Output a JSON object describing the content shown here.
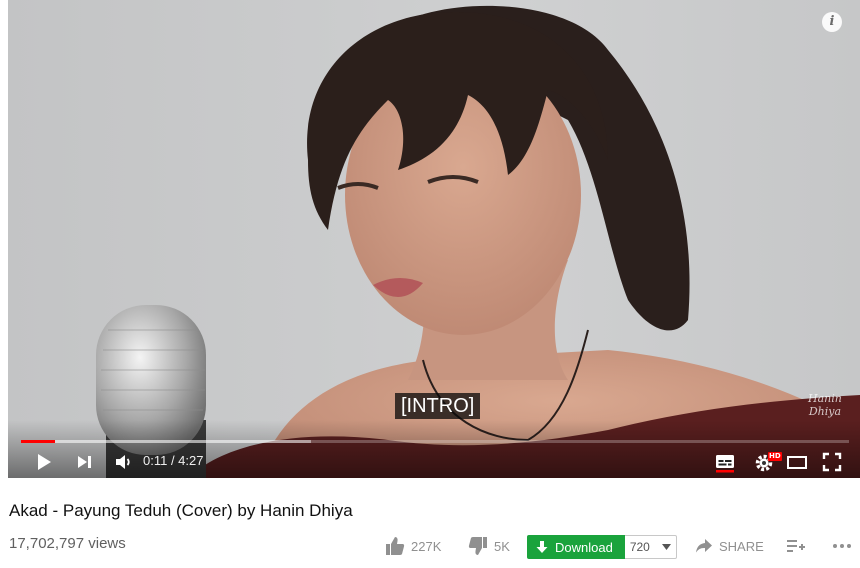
{
  "video": {
    "caption": "[INTRO]",
    "watermark_line1": "Hanin",
    "watermark_line2": "Dhiya",
    "info_glyph": "i",
    "info_icon": "info-icon"
  },
  "controls": {
    "time": "0:11 / 4:27",
    "progress_played": 0.041,
    "progress_buffered": 0.35,
    "accent_color": "#ff0000",
    "hd_badge": "HD",
    "icons": [
      "play-icon",
      "next-icon",
      "volume-icon",
      "subtitles-icon",
      "settings-icon",
      "theater-mode-icon",
      "fullscreen-icon"
    ]
  },
  "meta": {
    "title": "Akad - Payung Teduh (Cover) by Hanin Dhiya",
    "views": "17,702,797 views"
  },
  "actions": {
    "likes": "227K",
    "dislikes": "5K",
    "download_label": "Download",
    "download_color": "#1aa33c",
    "quality": "720",
    "share_label": "SHARE"
  }
}
